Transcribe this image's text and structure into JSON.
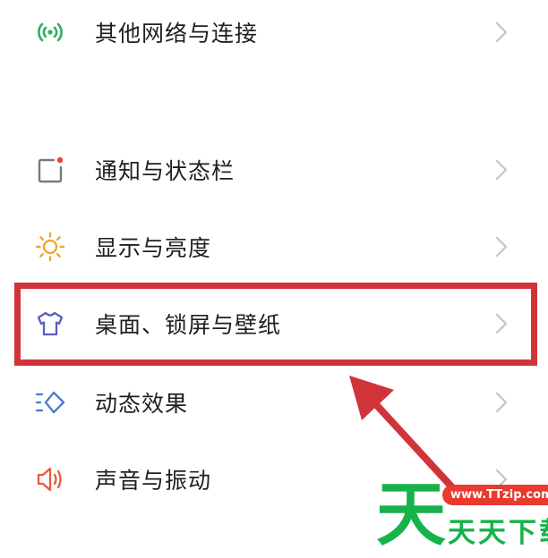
{
  "settings": {
    "items": [
      {
        "label": "其他网络与连接",
        "icon": "connection-icon",
        "icon_color": "#2eae5e"
      },
      {
        "label": "通知与状态栏",
        "icon": "notification-icon",
        "icon_color": "#7a7a7a",
        "dot_color": "#e8463c"
      },
      {
        "label": "显示与亮度",
        "icon": "sun-icon",
        "icon_color": "#f0a530"
      },
      {
        "label": "桌面、锁屏与壁纸",
        "icon": "shirt-icon",
        "icon_color": "#5b5fbf"
      },
      {
        "label": "动态效果",
        "icon": "motion-icon",
        "icon_color": "#4a7bd0"
      },
      {
        "label": "声音与振动",
        "icon": "speaker-icon",
        "icon_color": "#e85a3c"
      }
    ]
  },
  "annotation": {
    "highlight_color": "#d0343a"
  },
  "watermark": {
    "big_char": "天",
    "url": "www.TTzip.com",
    "name": "天天下载",
    "color": "#17b24a",
    "url_bg": "#e83a2e"
  }
}
